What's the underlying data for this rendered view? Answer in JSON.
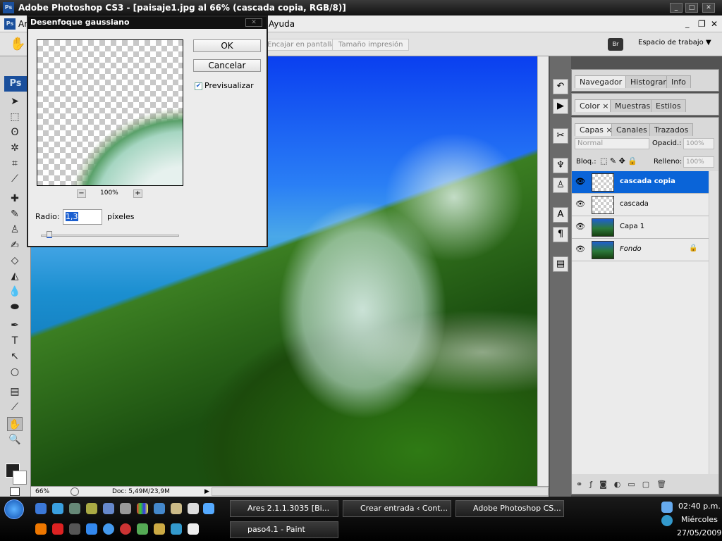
{
  "app": {
    "title": "Adobe Photoshop CS3 - [paisaje1.jpg al 66% (cascada copia, RGB/8)]",
    "logo": "Ps"
  },
  "menu": {
    "partial_first": "Ar",
    "help": "Ayuda"
  },
  "options": {
    "fit_screen": "Encajar en pantalla",
    "print_size": "Tamaño impresión",
    "workspace": "Espacio de trabajo ▼",
    "bridge_icon": "Br"
  },
  "status": {
    "zoom": "66%",
    "doc": "Doc: 5,49M/23,9M"
  },
  "dialog": {
    "title": "Desenfoque gaussiano",
    "ok": "OK",
    "cancel": "Cancelar",
    "preview_label": "Previsualizar",
    "preview_checked": true,
    "zoom_minus": "−",
    "zoom_plus": "+",
    "zoom_level": "100%",
    "radius_label": "Radio:",
    "radius_value": "1,3",
    "radius_unit": "píxeles"
  },
  "panels": {
    "group1": [
      "Navegador",
      "Histograma",
      "Info"
    ],
    "group2": [
      "Color",
      "Muestras",
      "Estilos"
    ],
    "group3": [
      "Capas",
      "Canales",
      "Trazados"
    ],
    "blend_mode": "Normal",
    "opacity_label": "Opacid.:",
    "opacity": "100%",
    "lock_label": "Bloq.:",
    "fill_label": "Relleno:",
    "fill": "100%",
    "layers": [
      {
        "name": "cascada copia",
        "selected": true
      },
      {
        "name": "cascada"
      },
      {
        "name": "Capa 1"
      },
      {
        "name": "Fondo",
        "locked": true
      }
    ]
  },
  "taskbar": {
    "tasks": [
      "Ares 2.1.1.3035  [Bi...",
      "Crear entrada ‹ Cont...",
      "Adobe Photoshop CS...",
      "paso4.1 - Paint"
    ],
    "time": "02:40 p.m.",
    "day": "Miércoles",
    "date": "27/05/2009"
  }
}
